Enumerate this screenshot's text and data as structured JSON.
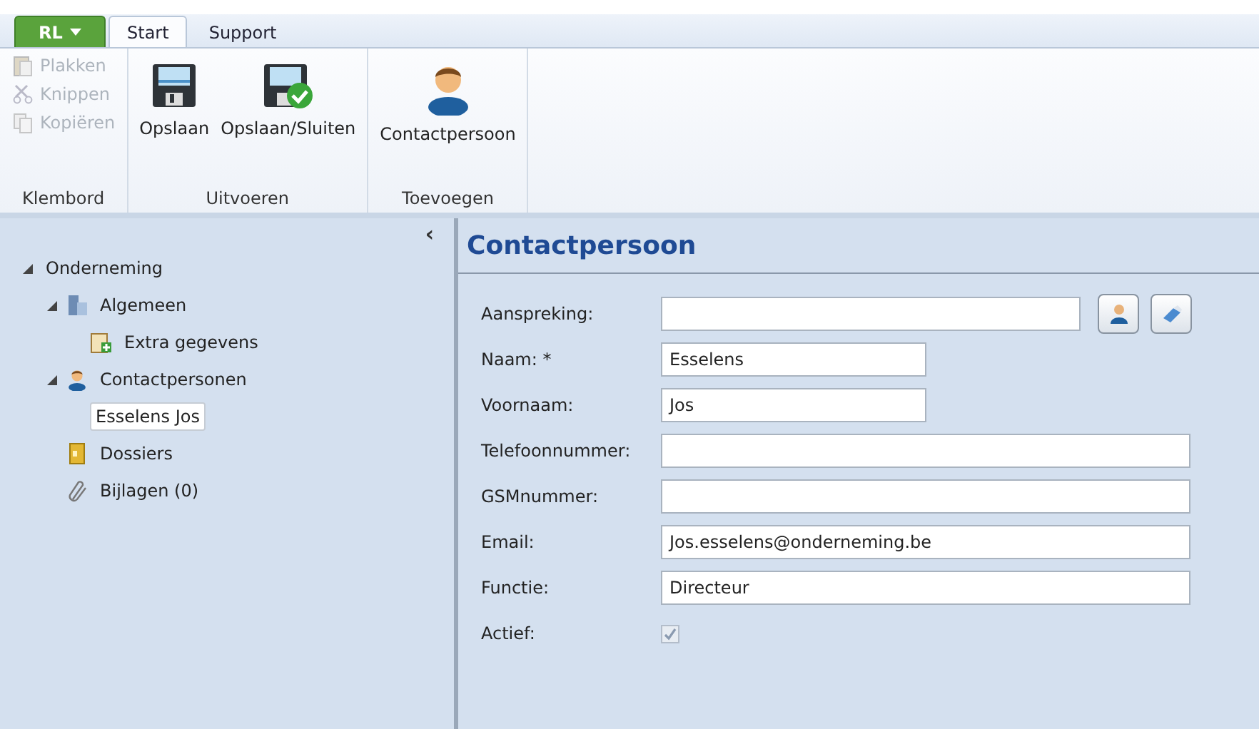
{
  "app_menu": {
    "label": "RL"
  },
  "tabs": [
    {
      "label": "Start",
      "selected": true
    },
    {
      "label": "Support",
      "selected": false
    }
  ],
  "ribbon_groups": [
    {
      "label": "Klembord",
      "buttons": [
        {
          "label": "Plakken",
          "disabled": true
        },
        {
          "label": "Knippen",
          "disabled": true
        },
        {
          "label": "Kopiëren",
          "disabled": true
        }
      ]
    },
    {
      "label": "Uitvoeren",
      "buttons": [
        {
          "label": "Opslaan",
          "disabled": false
        },
        {
          "label": "Opslaan/Sluiten",
          "disabled": false
        }
      ]
    },
    {
      "label": "Toevoegen",
      "buttons": [
        {
          "label": "Contactpersoon",
          "disabled": false
        }
      ]
    }
  ],
  "collapse_button": {
    "label": "‹"
  },
  "tree": [
    {
      "label": "Onderneming",
      "expanded": true,
      "selected": false,
      "children": [
        {
          "label": "Algemeen",
          "expanded": true,
          "selected": false,
          "children": [
            {
              "label": "Extra gegevens",
              "selected": false
            }
          ]
        },
        {
          "label": "Contactpersonen",
          "expanded": true,
          "selected": false,
          "children": [
            {
              "label": "Esselens Jos",
              "selected": true
            }
          ]
        },
        {
          "label": "Dossiers",
          "selected": false
        },
        {
          "label": "Bijlagen (0)",
          "selected": false
        }
      ]
    }
  ],
  "form": {
    "title": "Contactpersoon",
    "fields": [
      {
        "kind": "text",
        "label": "Aanspreking:"
      },
      {
        "kind": "text",
        "label": "Naam: *",
        "value": "Esselens"
      },
      {
        "kind": "text",
        "label": "Voornaam:",
        "value": "Jos"
      },
      {
        "kind": "text",
        "label": "Telefoonnummer:"
      },
      {
        "kind": "text",
        "label": "GSMnummer:"
      },
      {
        "kind": "text",
        "label": "Email:",
        "value": "Jos.esselens@onderneming.be"
      },
      {
        "kind": "text",
        "label": "Functie:",
        "value": "Directeur"
      },
      {
        "kind": "checkbox",
        "label": "Actief:",
        "checked": true,
        "disabled": true
      }
    ]
  }
}
